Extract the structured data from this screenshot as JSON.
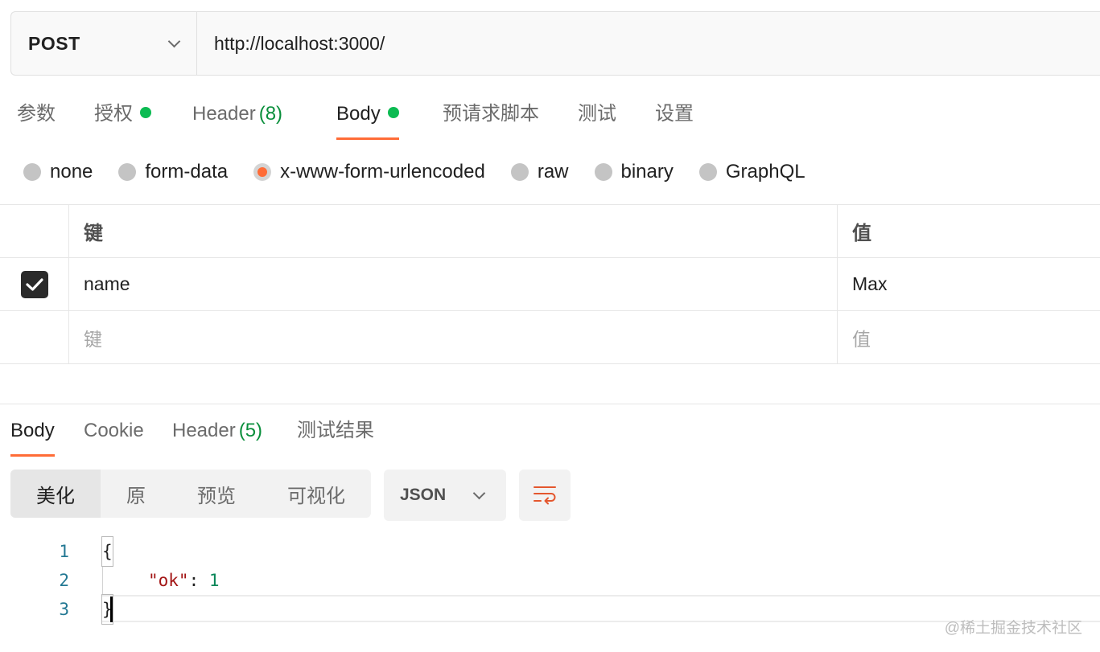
{
  "request": {
    "method": "POST",
    "url": "http://localhost:3000/"
  },
  "req_tabs": [
    {
      "label": "参数"
    },
    {
      "label": "授权"
    },
    {
      "label": "Header",
      "count": "(8)"
    },
    {
      "label": "Body"
    },
    {
      "label": "预请求脚本"
    },
    {
      "label": "测试"
    },
    {
      "label": "设置"
    }
  ],
  "body_types": [
    "none",
    "form-data",
    "x-www-form-urlencoded",
    "raw",
    "binary",
    "GraphQL"
  ],
  "kv_table": {
    "header_key": "键",
    "header_value": "值",
    "rows": [
      {
        "key": "name",
        "value": "Max",
        "checked": true
      }
    ],
    "placeholder_key": "键",
    "placeholder_value": "值"
  },
  "resp_tabs": [
    {
      "label": "Body"
    },
    {
      "label": "Cookie"
    },
    {
      "label": "Header",
      "count": "(5)"
    },
    {
      "label": "测试结果"
    }
  ],
  "view_modes": [
    "美化",
    "原",
    "预览",
    "可视化"
  ],
  "format": "JSON",
  "code": {
    "line_numbers": [
      "1",
      "2",
      "3"
    ],
    "open_brace": "{",
    "key": "\"ok\"",
    "colon": ": ",
    "value": "1",
    "close_brace": "}"
  },
  "watermark": "@稀土掘金技术社区",
  "colors": {
    "accent": "#ff6c37",
    "dot": "#0cbb52",
    "count": "#0a8f3c"
  }
}
